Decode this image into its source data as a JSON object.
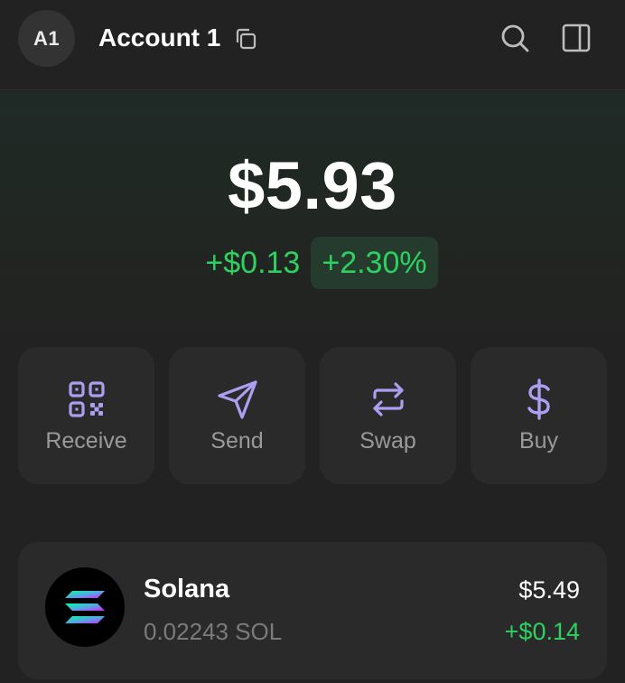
{
  "header": {
    "avatar_initials": "A1",
    "account_name": "Account 1",
    "icons": [
      "copy-icon",
      "search-icon",
      "sidebar-panel-icon"
    ]
  },
  "balance": {
    "total": "$5.93",
    "change_abs": "+$0.13",
    "change_pct": "+2.30%"
  },
  "actions": [
    {
      "label": "Receive",
      "icon": "qr-code-icon"
    },
    {
      "label": "Send",
      "icon": "paper-plane-icon"
    },
    {
      "label": "Swap",
      "icon": "swap-arrows-icon"
    },
    {
      "label": "Buy",
      "icon": "dollar-icon"
    }
  ],
  "tokens": [
    {
      "name": "Solana",
      "amount": "0.02243 SOL",
      "value": "$5.49",
      "change": "+$0.14",
      "icon": "solana-logo"
    }
  ],
  "colors": {
    "background": "#222222",
    "card": "#2a2a2a",
    "accent": "#ab9ff2",
    "positive": "#2ed160",
    "positive_badge_bg": "#243b2d",
    "muted_text": "#9a9a9a"
  }
}
